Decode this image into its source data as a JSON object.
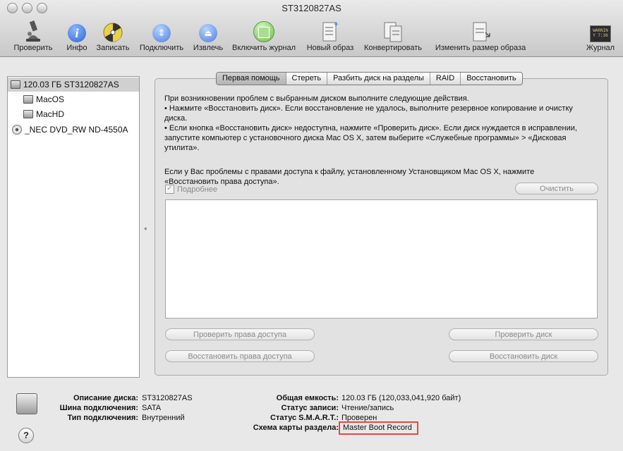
{
  "window": {
    "title": "ST3120827AS"
  },
  "toolbar": {
    "verify": "Проверить",
    "info": "Инфо",
    "burn": "Записать",
    "mount": "Подключить",
    "eject": "Извлечь",
    "enable_journal": "Включить журнал",
    "new_image": "Новый образ",
    "convert": "Конвертировать",
    "resize_image": "Изменить размер образа",
    "log": "Журнал",
    "log_icon_text": "WARNIN\nY 7:36"
  },
  "sidebar": {
    "disk": "120.03 ГБ ST3120827AS",
    "vol1": "MacOS",
    "vol2": "MacHD",
    "dvd": "_NEC DVD_RW ND-4550A"
  },
  "tabs": {
    "first_aid": "Первая помощь",
    "erase": "Стереть",
    "partition": "Разбить диск на разделы",
    "raid": "RAID",
    "restore": "Восстановить"
  },
  "firstaid": {
    "intro": "При возникновении проблем с выбранным диском выполните следующие действия.",
    "bullet1": "• Нажмите «Восстановить диск». Если восстановление не удалось, выполните резервное копирование и очистку диска.",
    "bullet2": "• Если кнопка «Восстановить диск» недоступна, нажмите «Проверить диск». Если диск нуждается в исправлении, запустите компьютер с установочного диска Mac OS X, затем выберите «Служебные программы» > «Дисковая утилита».",
    "permissions_note": "Если у Вас проблемы с правами доступа к файлу, установленному Установщиком Mac OS X, нажмите «Восстановить права доступа».",
    "details_label": "Подробнее",
    "clear_btn": "Очистить",
    "verify_perms_btn": "Проверить права доступа",
    "repair_perms_btn": "Восстановить права доступа",
    "verify_disk_btn": "Проверить диск",
    "repair_disk_btn": "Восстановить диск"
  },
  "info": {
    "desc_label": "Описание диска:",
    "desc_value": "ST3120827AS",
    "bus_label": "Шина подключения:",
    "bus_value": "SATA",
    "type_label": "Тип подключения:",
    "type_value": "Внутренний",
    "capacity_label": "Общая емкость:",
    "capacity_value": "120.03 ГБ (120,033,041,920 байт)",
    "write_label": "Статус записи:",
    "write_value": "Чтение/запись",
    "smart_label": "Статус S.M.A.R.T.:",
    "smart_value": "Проверен",
    "scheme_label": "Схема карты раздела:",
    "scheme_value": "Master Boot Record"
  },
  "help": {
    "label": "?"
  }
}
